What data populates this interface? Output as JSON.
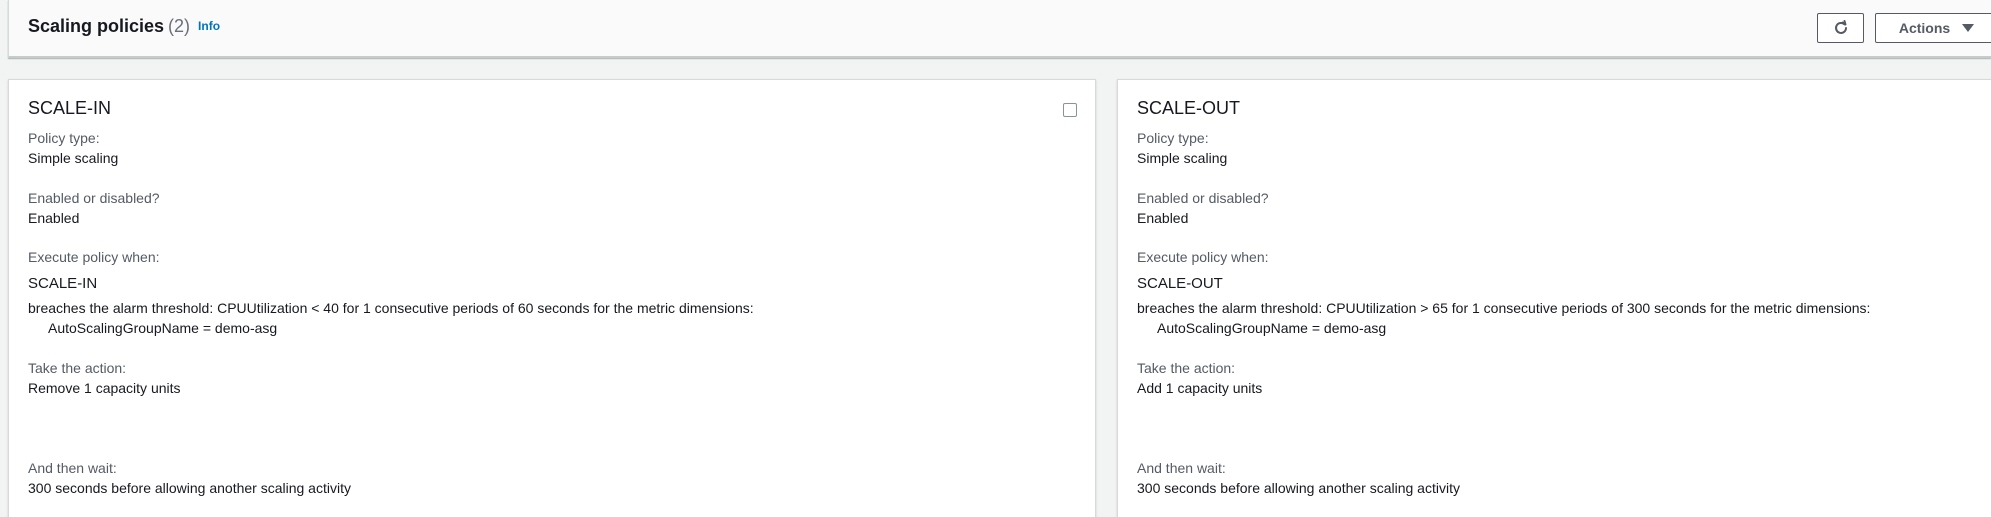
{
  "header": {
    "title": "Scaling policies",
    "count": "(2)",
    "info_label": "Info",
    "actions_label": "Actions"
  },
  "policies": [
    {
      "name": "SCALE-IN",
      "policy_type_label": "Policy type:",
      "policy_type": "Simple scaling",
      "enabled_label": "Enabled or disabled?",
      "enabled": "Enabled",
      "execute_label": "Execute policy when:",
      "alarm_name": "SCALE-IN",
      "alarm_condition": "breaches the alarm threshold: CPUUtilization < 40 for 1 consecutive periods of 60 seconds for the metric dimensions:",
      "alarm_dimension": "AutoScalingGroupName = demo-asg",
      "action_label": "Take the action:",
      "action": "Remove 1 capacity units",
      "wait_label": "And then wait:",
      "wait": "300 seconds before allowing another scaling activity"
    },
    {
      "name": "SCALE-OUT",
      "policy_type_label": "Policy type:",
      "policy_type": "Simple scaling",
      "enabled_label": "Enabled or disabled?",
      "enabled": "Enabled",
      "execute_label": "Execute policy when:",
      "alarm_name": "SCALE-OUT",
      "alarm_condition": "breaches the alarm threshold: CPUUtilization > 65 for 1 consecutive periods of 300 seconds for the metric dimensions:",
      "alarm_dimension": "AutoScalingGroupName = demo-asg",
      "action_label": "Take the action:",
      "action": "Add 1 capacity units",
      "wait_label": "And then wait:",
      "wait": "300 seconds before allowing another scaling activity"
    }
  ],
  "icons": {
    "refresh": "refresh-icon",
    "actions_caret": "caret-down-icon"
  },
  "colors": {
    "link": "#0073bb",
    "text": "#16191f",
    "secondary_text": "#545b64",
    "background": "#f2f3f3"
  }
}
